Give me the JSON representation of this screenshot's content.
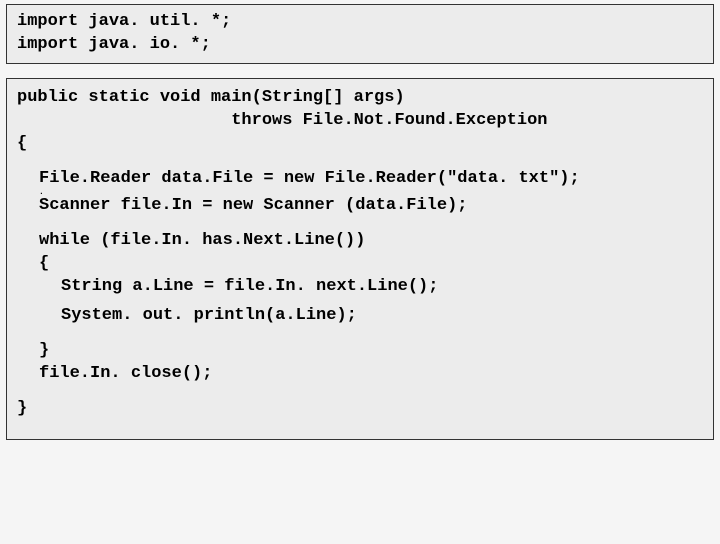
{
  "imports": {
    "line1": "import java. util. *;",
    "line2": "import java. io. *;"
  },
  "main": {
    "sig1": "public static void main(String[] args)",
    "sig2": "                     throws File.Not.Found.Exception",
    "brace_open": "{",
    "filereader": "File.Reader data.File = new File.Reader(\"data. txt\");",
    "dot": ".",
    "scanner": "Scanner file.In = new Scanner (data.File);",
    "while_line": "while (file.In. has.Next.Line())",
    "while_open": "{",
    "body1": "String a.Line = file.In. next.Line();",
    "body2": "System. out. println(a.Line);",
    "while_close": "}",
    "close_call": "file.In. close();",
    "brace_close": "}"
  }
}
